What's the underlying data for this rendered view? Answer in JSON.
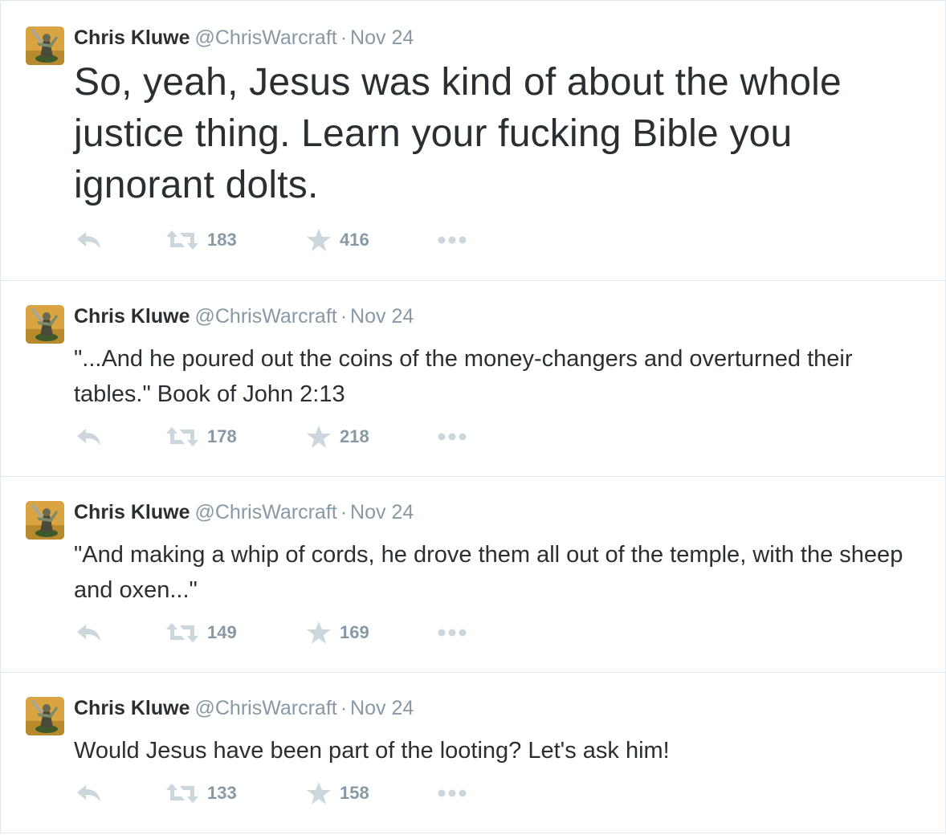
{
  "tweets": [
    {
      "fullname": "Chris Kluwe",
      "username": "@ChrisWarcraft",
      "separator": "·",
      "time": "Nov 24",
      "text": "So, yeah, Jesus was kind of about the whole justice thing. Learn your fucking Bible you ignorant dolts.",
      "retweets": "183",
      "favorites": "416"
    },
    {
      "fullname": "Chris Kluwe",
      "username": "@ChrisWarcraft",
      "separator": "·",
      "time": "Nov 24",
      "text": "\"...And he poured out the coins of the money-changers and overturned their tables.\" Book of John 2:13",
      "retweets": "178",
      "favorites": "218"
    },
    {
      "fullname": "Chris Kluwe",
      "username": "@ChrisWarcraft",
      "separator": "·",
      "time": "Nov 24",
      "text": "\"And making a whip of cords, he drove them all out of the temple, with the sheep and oxen...\"",
      "retweets": "149",
      "favorites": "169"
    },
    {
      "fullname": "Chris Kluwe",
      "username": "@ChrisWarcraft",
      "separator": "·",
      "time": "Nov 24",
      "text": "Would Jesus have been part of the looting? Let's ask him!",
      "retweets": "133",
      "favorites": "158"
    }
  ],
  "icons": {
    "reply": "reply-icon",
    "retweet": "retweet-icon",
    "favorite": "star-icon",
    "more": "more-dots-icon",
    "avatar": "avatar"
  },
  "colors": {
    "text": "#292f33",
    "muted": "#8899a6",
    "icon": "#ccd6dd",
    "border": "#e1e8ed"
  }
}
